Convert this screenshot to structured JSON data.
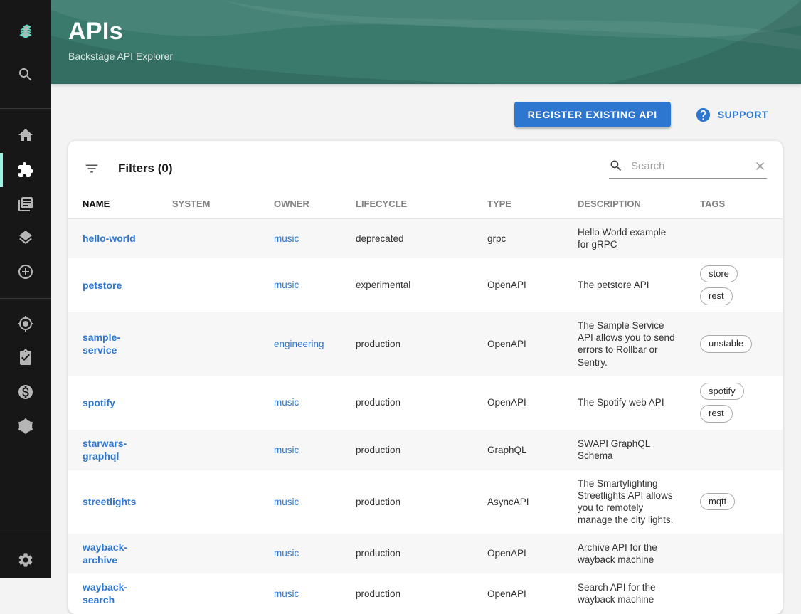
{
  "header": {
    "title": "APIs",
    "subtitle": "Backstage API Explorer"
  },
  "sidebar": {
    "icons": [
      "backstage-logo-icon",
      "search-icon",
      "home-icon",
      "extension-puzzle-icon",
      "library-books-icon",
      "layers-icon",
      "add-circle-icon",
      "gps-target-icon",
      "clipboard-check-icon",
      "dollar-circle-icon",
      "graphql-icon",
      "settings-gear-icon"
    ],
    "selected": "extension-puzzle-icon"
  },
  "actions": {
    "register_label": "REGISTER EXISTING API",
    "support_label": "SUPPORT"
  },
  "filters": {
    "label": "Filters (0)"
  },
  "search": {
    "placeholder": "Search",
    "value": ""
  },
  "table": {
    "columns": [
      "NAME",
      "SYSTEM",
      "OWNER",
      "LIFECYCLE",
      "TYPE",
      "DESCRIPTION",
      "TAGS"
    ],
    "rows": [
      {
        "name": "hello-world",
        "system": "",
        "owner": "music",
        "lifecycle": "deprecated",
        "type": "grpc",
        "description": "Hello World example for gRPC",
        "tags": []
      },
      {
        "name": "petstore",
        "system": "",
        "owner": "music",
        "lifecycle": "experimental",
        "type": "OpenAPI",
        "description": "The petstore API",
        "tags": [
          "store",
          "rest"
        ]
      },
      {
        "name": "sample-service",
        "system": "",
        "owner": "engineering",
        "lifecycle": "production",
        "type": "OpenAPI",
        "description": "The Sample Service API allows you to send errors to Rollbar or Sentry.",
        "tags": [
          "unstable"
        ]
      },
      {
        "name": "spotify",
        "system": "",
        "owner": "music",
        "lifecycle": "production",
        "type": "OpenAPI",
        "description": "The Spotify web API",
        "tags": [
          "spotify",
          "rest"
        ]
      },
      {
        "name": "starwars-graphql",
        "system": "",
        "owner": "music",
        "lifecycle": "production",
        "type": "GraphQL",
        "description": "SWAPI GraphQL Schema",
        "tags": []
      },
      {
        "name": "streetlights",
        "system": "",
        "owner": "music",
        "lifecycle": "production",
        "type": "AsyncAPI",
        "description": "The Smartylighting Streetlights API allows you to remotely manage the city lights.",
        "tags": [
          "mqtt"
        ]
      },
      {
        "name": "wayback-archive",
        "system": "",
        "owner": "music",
        "lifecycle": "production",
        "type": "OpenAPI",
        "description": "Archive API for the wayback machine",
        "tags": []
      },
      {
        "name": "wayback-search",
        "system": "",
        "owner": "music",
        "lifecycle": "production",
        "type": "OpenAPI",
        "description": "Search API for the wayback machine",
        "tags": []
      }
    ]
  },
  "colors": {
    "accent_blue": "#2e77d0",
    "brand_teal": "#9bf0e1",
    "logo_teal": "#5ce0c3",
    "header_green": "#377467",
    "sidebar_bg": "#171717"
  }
}
